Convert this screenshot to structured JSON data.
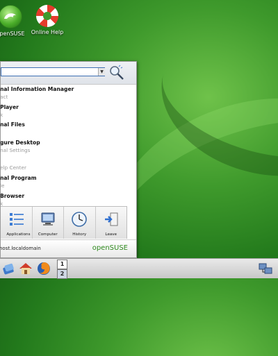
{
  "desktop": {
    "icons": [
      {
        "label": "openSUSE",
        "icon": "opensuse-gecko-icon"
      },
      {
        "label": "Online Help",
        "icon": "lifebuoy-icon"
      }
    ]
  },
  "menu": {
    "search": {
      "value": "",
      "placeholder": ""
    },
    "items": [
      {
        "title": "nal Information Manager",
        "subtitle": "act"
      },
      {
        "title": "Player",
        "subtitle": "k"
      },
      {
        "title": "nal Files",
        "subtitle": ""
      },
      {
        "title": "gure Desktop",
        "subtitle": "nal Settings"
      },
      {
        "title": "",
        "subtitle": "elp Center"
      },
      {
        "title": "nal Program",
        "subtitle": "le"
      },
      {
        "title": "Browser",
        "subtitle": "k"
      }
    ],
    "tabs": [
      {
        "label": "Applications",
        "icon": "applications-icon"
      },
      {
        "label": "Computer",
        "icon": "computer-icon"
      },
      {
        "label": "History",
        "icon": "history-clock-icon"
      },
      {
        "label": "Leave",
        "icon": "leave-icon"
      }
    ],
    "footer": {
      "host": "nost.localdomain",
      "brand": "openSUSE"
    }
  },
  "taskbar": {
    "launchers": [
      "kickoff-menu-icon",
      "home-icon",
      "firefox-icon"
    ],
    "pager": [
      "1",
      "2"
    ],
    "tray": "network-tray-icon"
  }
}
